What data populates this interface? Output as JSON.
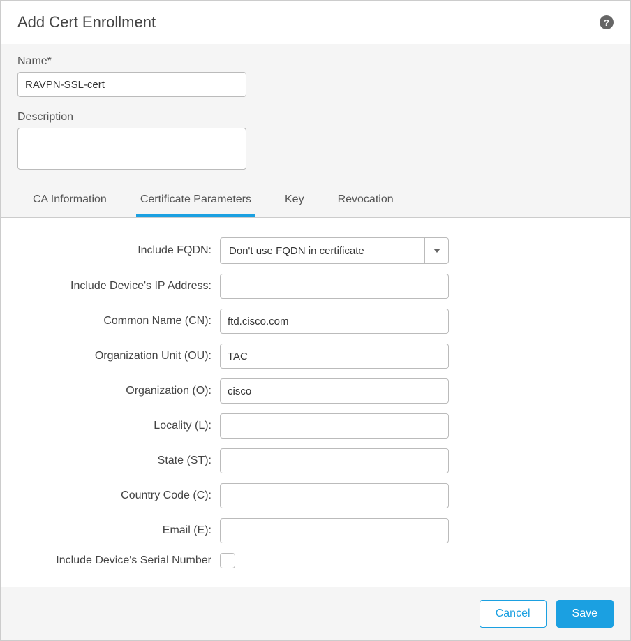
{
  "dialog": {
    "title": "Add Cert Enrollment"
  },
  "top": {
    "name_label": "Name*",
    "name_value": "RAVPN-SSL-cert",
    "description_label": "Description",
    "description_value": ""
  },
  "tabs": [
    {
      "label": "CA Information",
      "active": false
    },
    {
      "label": "Certificate Parameters",
      "active": true
    },
    {
      "label": "Key",
      "active": false
    },
    {
      "label": "Revocation",
      "active": false
    }
  ],
  "form": {
    "include_fqdn_label": "Include FQDN:",
    "include_fqdn_value": "Don't use FQDN in certificate",
    "ip_label": "Include Device's IP Address:",
    "ip_value": "",
    "cn_label": "Common Name (CN):",
    "cn_value": "ftd.cisco.com",
    "ou_label": "Organization Unit (OU):",
    "ou_value": "TAC",
    "o_label": "Organization (O):",
    "o_value": "cisco",
    "locality_label": "Locality (L):",
    "locality_value": "",
    "state_label": "State (ST):",
    "state_value": "",
    "country_label": "Country Code (C):",
    "country_value": "",
    "email_label": "Email (E):",
    "email_value": "",
    "serial_label": "Include Device's Serial Number"
  },
  "footer": {
    "cancel_label": "Cancel",
    "save_label": "Save"
  }
}
